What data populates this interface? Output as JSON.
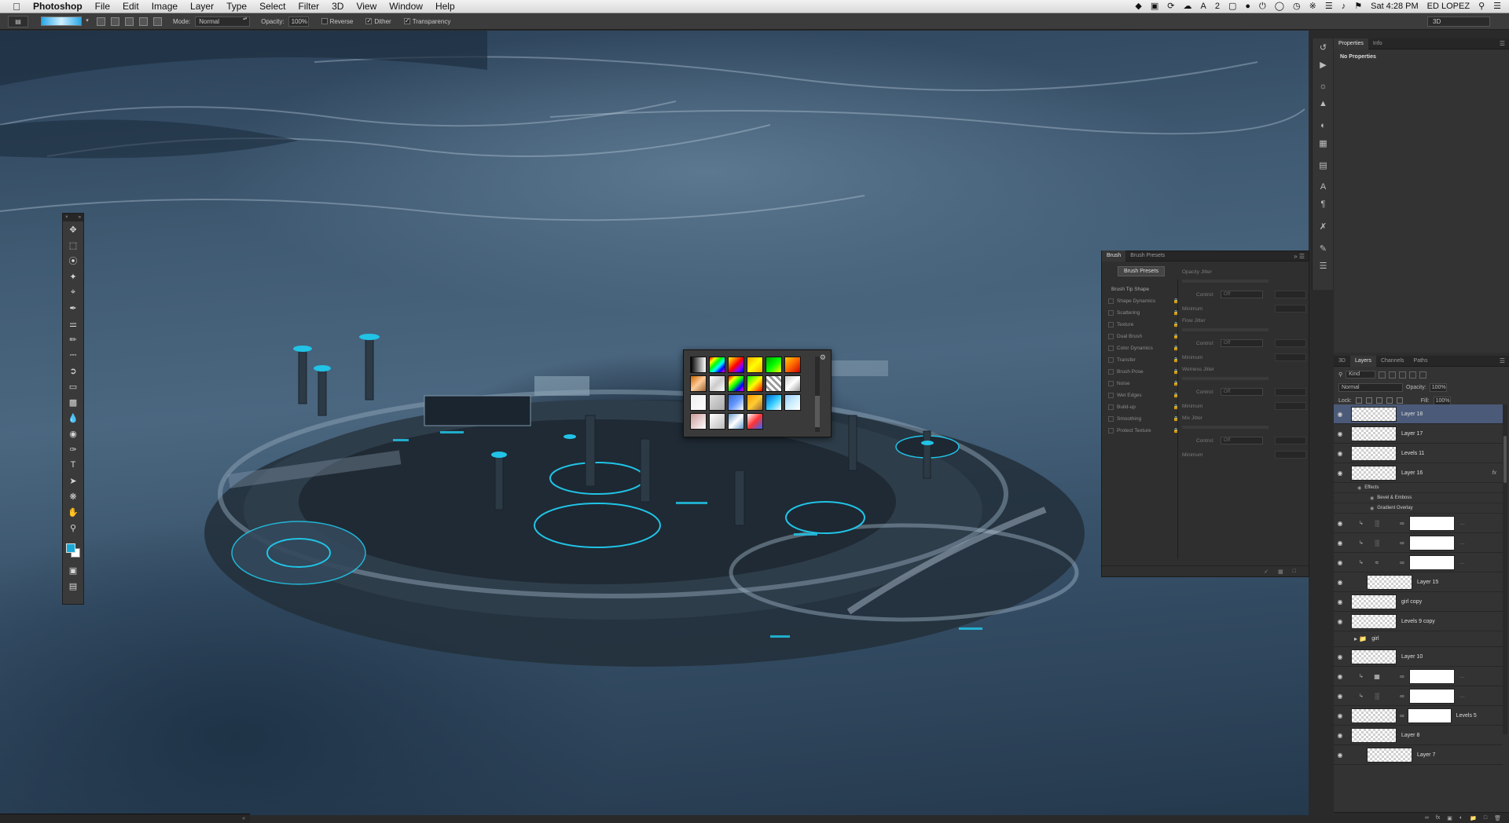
{
  "menubar": {
    "app_name": "Photoshop",
    "menus": [
      "File",
      "Edit",
      "Image",
      "Layer",
      "Type",
      "Select",
      "Filter",
      "3D",
      "View",
      "Window",
      "Help"
    ],
    "badge_text": "2",
    "clock": "Sat 4:28 PM",
    "user": "ED LOPEZ"
  },
  "options": {
    "mode_label": "Mode:",
    "mode_value": "Normal",
    "opacity_label": "Opacity:",
    "opacity_value": "100%",
    "reverse": "Reverse",
    "dither": "Dither",
    "transparency": "Transparency",
    "workspace": "3D",
    "gradient_colors": [
      "#2aa8e6",
      "#cfefff"
    ]
  },
  "properties": {
    "tabs": [
      "Properties",
      "Info"
    ],
    "body": "No Properties"
  },
  "layers_panel": {
    "tabs": [
      "3D",
      "Layers",
      "Channels",
      "Paths"
    ],
    "kind_label": "Kind",
    "blend_mode": "Normal",
    "opacity_label": "Opacity:",
    "opacity_value": "100%",
    "lock_label": "Lock:",
    "fill_label": "Fill:",
    "fill_value": "100%",
    "layers": [
      {
        "name": "Layer 18"
      },
      {
        "name": "Layer 17"
      },
      {
        "name": "Levels 11"
      },
      {
        "name": "Layer 16",
        "fx": "fx"
      },
      {
        "name": "Effects"
      },
      {
        "name": "Bevel & Emboss"
      },
      {
        "name": "Gradient Overlay"
      },
      {
        "name": "Layer 15"
      },
      {
        "name": "girl copy"
      },
      {
        "name": "Levels 9 copy"
      },
      {
        "name": "girl"
      },
      {
        "name": "Layer 10"
      },
      {
        "name": "Levels 5"
      },
      {
        "name": "Layer 8"
      },
      {
        "name": "Layer 7"
      }
    ]
  },
  "brush_panel": {
    "tabs": [
      "Brush",
      "Brush Presets"
    ],
    "presets_button": "Brush Presets",
    "tip_shape": "Brush Tip Shape",
    "options": [
      "Shape Dynamics",
      "Scattering",
      "Texture",
      "Dual Brush",
      "Color Dynamics",
      "Transfer",
      "Brush Pose",
      "Noise",
      "Wet Edges",
      "Build-up",
      "Smoothing",
      "Protect Texture"
    ],
    "right_headers": [
      "Opacity Jitter",
      "Flow Jitter",
      "Wetness Jitter",
      "Mix Jitter"
    ],
    "control_label": "Control:",
    "control_value": "Off",
    "minimum_label": "Minimum"
  },
  "gradient_picker": {
    "swatches": [
      "linear-gradient(90deg,#000,#fff)",
      "linear-gradient(135deg,#f00,#ff0,#0f0,#0ff,#00f,#f0f)",
      "linear-gradient(135deg,#ff0,#f80,#f00,#80f,#00f)",
      "linear-gradient(135deg,#fa0,#ff0,#fa0)",
      "linear-gradient(135deg,#0a0,#0f0,#ff0)",
      "linear-gradient(135deg,#fc0,#f60,#c00)",
      "linear-gradient(135deg,#c60,#fc9,#963)",
      "linear-gradient(135deg,#fff,#ccc,#fff)",
      "linear-gradient(135deg,#f00,#ff0,#0f0,#00f,#f0f)",
      "linear-gradient(135deg,#0f0,#ff0,#f00)",
      "repeating-linear-gradient(45deg,#fff 0 3px,#999 3px 6px)",
      "linear-gradient(135deg,#ccc,#fff,#999)",
      "linear-gradient(135deg,#eee,#fff)",
      "linear-gradient(135deg,#ddd,#aaa)",
      "linear-gradient(135deg,#36c,#69f,#fff)",
      "linear-gradient(135deg,#f90,#fc3,#963)",
      "linear-gradient(135deg,#06c,#3cf,#fff)",
      "linear-gradient(135deg,#9cf,#cef,#fff)",
      "linear-gradient(135deg,#c99,#fff)",
      "linear-gradient(135deg,#fff,#bbb)",
      "linear-gradient(135deg,#69c,#fff,#69c)",
      "linear-gradient(135deg,#fff,#f33,#36f)"
    ]
  }
}
